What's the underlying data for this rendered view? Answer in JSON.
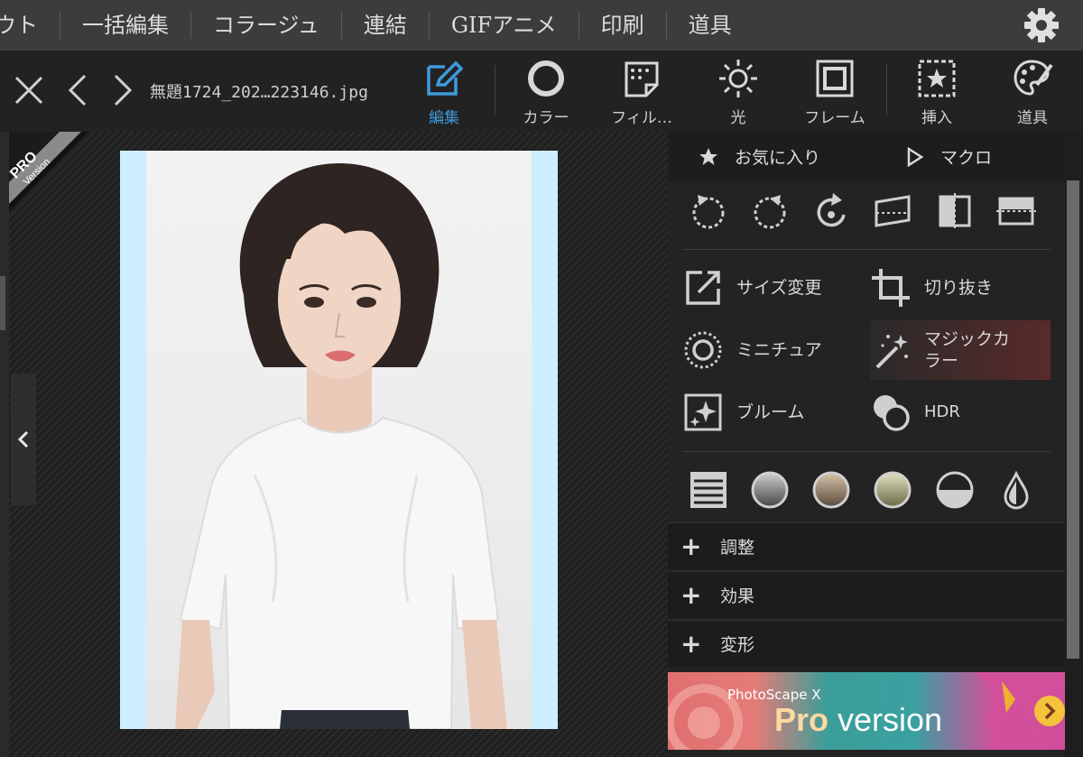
{
  "menu": {
    "items": [
      "ウト",
      "一括編集",
      "コラージュ",
      "連結",
      "GIFアニメ",
      "印刷",
      "道具"
    ]
  },
  "toolbar": {
    "filename": "無題1724_202…223146.jpg",
    "tools": {
      "edit": "編集",
      "color": "カラー",
      "filter": "フィル…",
      "light": "光",
      "frame": "フレーム",
      "insert": "挿入",
      "tools": "道具"
    }
  },
  "badge": {
    "pro": "PRO",
    "version": "Version"
  },
  "panel": {
    "favorites": "お気に入り",
    "macro": "マクロ",
    "features": {
      "resize": "サイズ変更",
      "crop": "切り抜き",
      "miniature": "ミニチュア",
      "magic_color_line1": "マジックカ",
      "magic_color_line2": "ラー",
      "bloom": "ブルーム",
      "hdr": "HDR"
    },
    "accordions": [
      "調整",
      "効果",
      "変形"
    ],
    "promo": {
      "small": "PhotoScape X",
      "pro": "Pro",
      "version": " version"
    }
  },
  "colors": {
    "accent": "#3e9bdc",
    "panel": "#232323",
    "menubar": "#3c3c3c"
  }
}
